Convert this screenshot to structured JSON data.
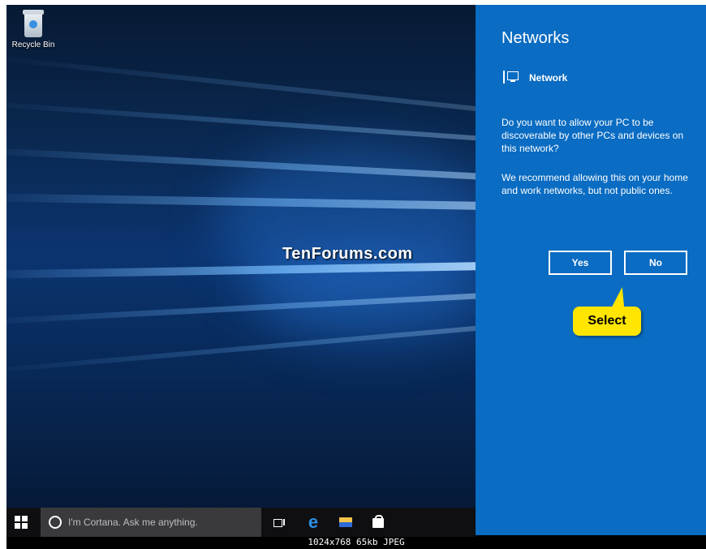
{
  "desktop": {
    "recycle_bin_label": "Recycle Bin",
    "watermark": "TenForums.com"
  },
  "taskbar": {
    "search_text": "I'm Cortana. Ask me anything.",
    "icons": [
      "windows-start-icon",
      "cortana-circle-icon",
      "task-view-icon",
      "edge-icon",
      "file-explorer-icon",
      "store-icon"
    ]
  },
  "panel": {
    "title": "Networks",
    "network_name": "Network",
    "question": "Do you want to allow your PC to be discoverable by other PCs and devices on this network?",
    "recommendation": "We recommend allowing this on your home and work networks, but not public ones.",
    "yes_label": "Yes",
    "no_label": "No",
    "background_color": "#0a6cc2"
  },
  "callout": {
    "text": "Select",
    "color": "#ffe500"
  },
  "caption": "1024x768 65kb JPEG"
}
